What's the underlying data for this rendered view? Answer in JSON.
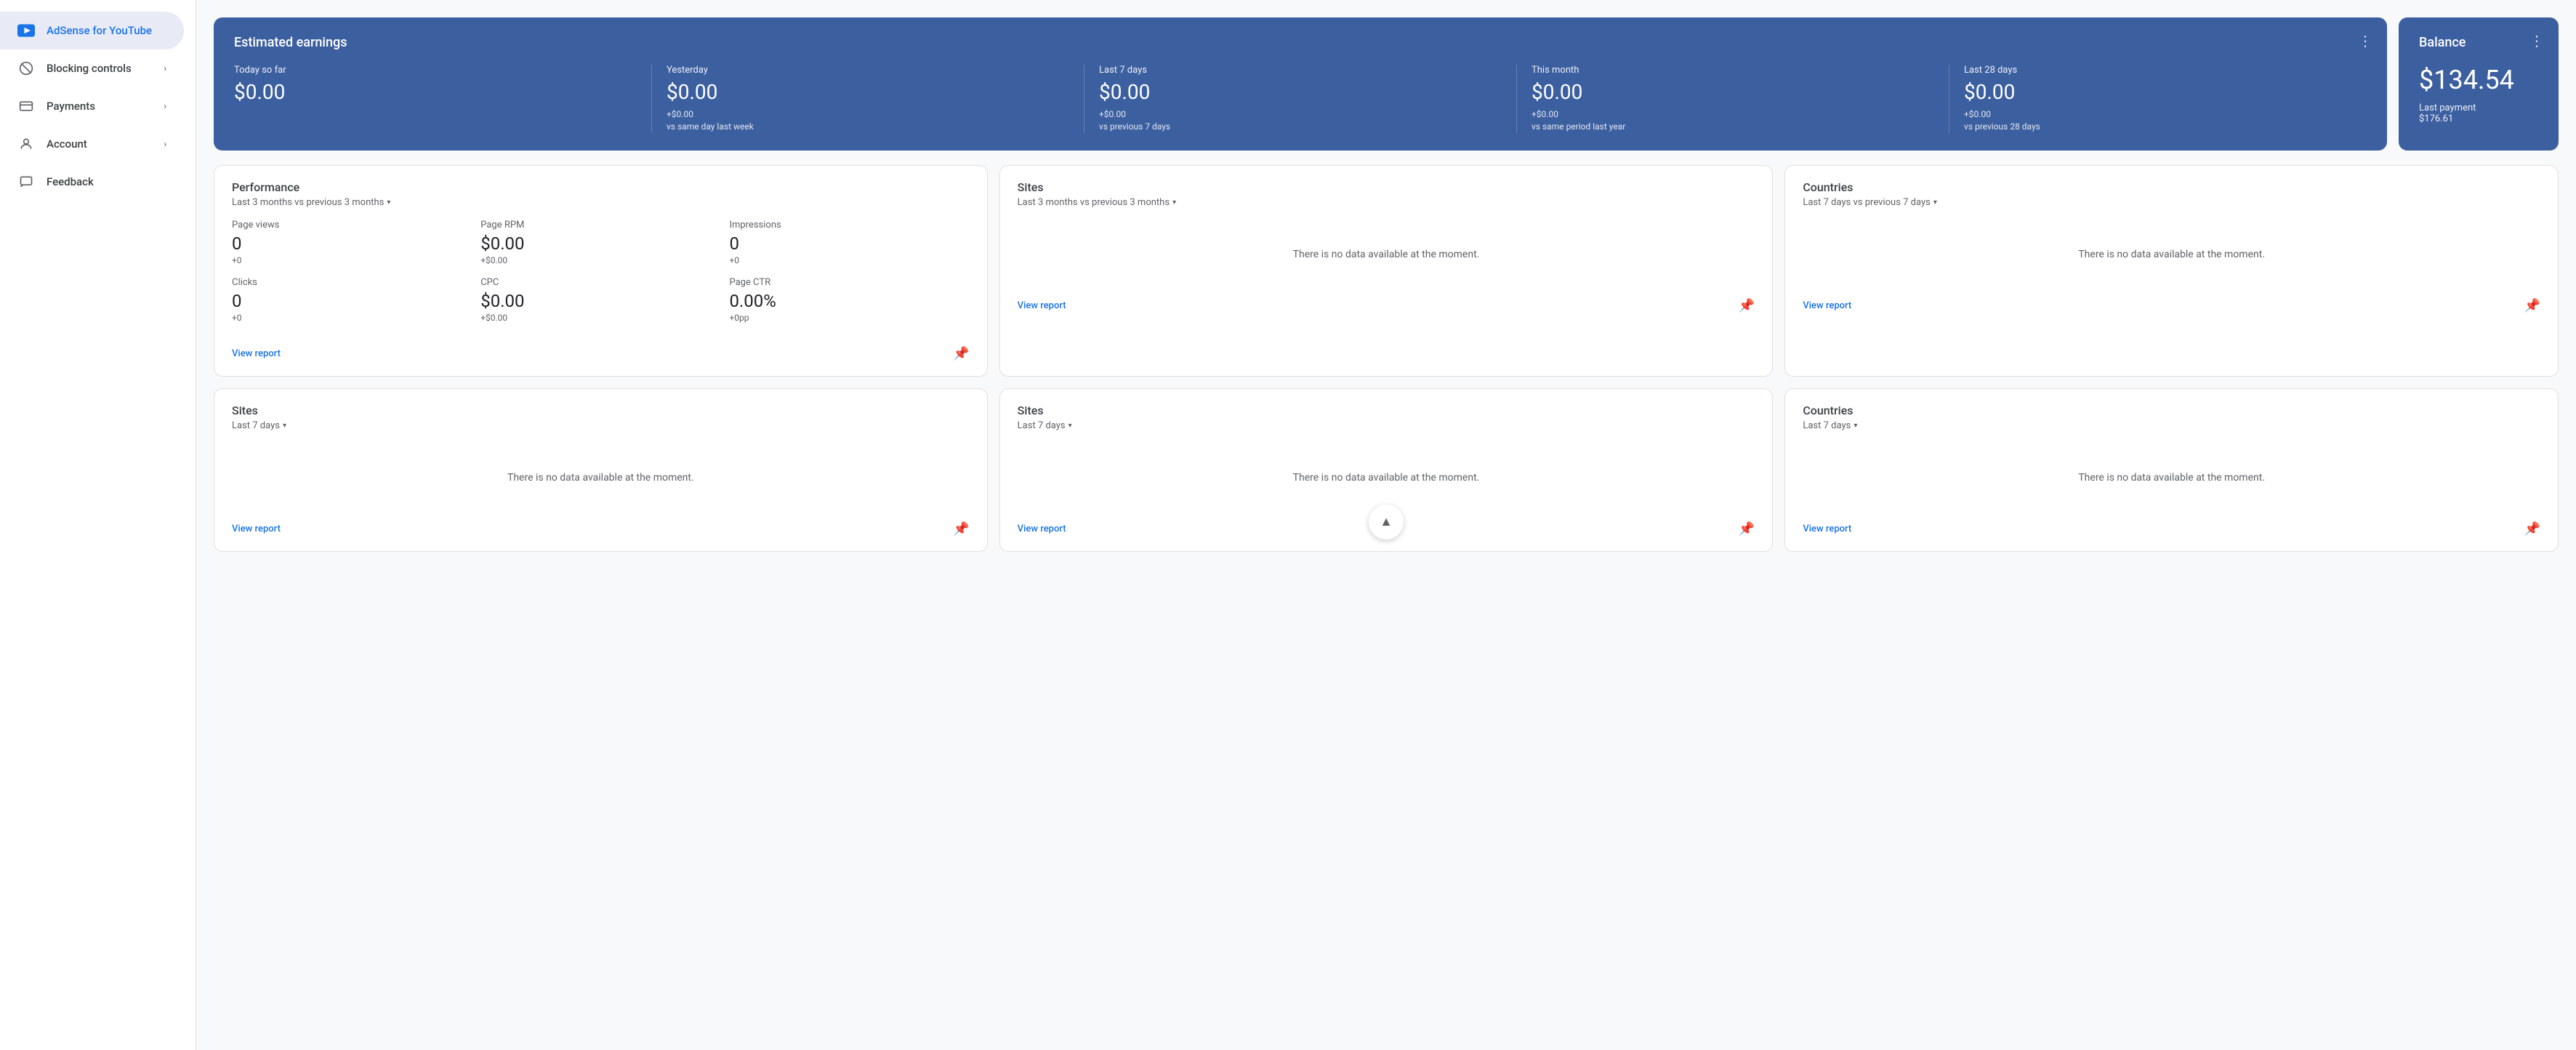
{
  "sidebar": {
    "app_name": "AdSense for YouTube",
    "items": [
      {
        "id": "adsense",
        "label": "AdSense for YouTube",
        "active": true
      },
      {
        "id": "blocking",
        "label": "Blocking controls",
        "active": false,
        "has_arrow": true
      },
      {
        "id": "payments",
        "label": "Payments",
        "active": false,
        "has_arrow": true
      },
      {
        "id": "account",
        "label": "Account",
        "active": false,
        "has_arrow": true
      },
      {
        "id": "feedback",
        "label": "Feedback",
        "active": false
      }
    ]
  },
  "earnings": {
    "card_title": "Estimated earnings",
    "columns": [
      {
        "period": "Today so far",
        "amount": "$0.00",
        "delta": null,
        "delta2": null
      },
      {
        "period": "Yesterday",
        "amount": "$0.00",
        "delta": "+$0.00",
        "delta2": "vs same day last week"
      },
      {
        "period": "Last 7 days",
        "amount": "$0.00",
        "delta": "+$0.00",
        "delta2": "vs previous 7 days"
      },
      {
        "period": "This month",
        "amount": "$0.00",
        "delta": "+$0.00",
        "delta2": "vs same period last year"
      },
      {
        "period": "Last 28 days",
        "amount": "$0.00",
        "delta": "+$0.00",
        "delta2": "vs previous 28 days"
      }
    ]
  },
  "balance": {
    "title": "Balance",
    "amount": "$134.54",
    "last_payment_label": "Last payment",
    "last_payment_value": "$176.61"
  },
  "performance_widget": {
    "title": "Performance",
    "subtitle": "Last 3 months vs previous 3 months",
    "metrics": [
      {
        "label": "Page views",
        "value": "0",
        "delta": "+0",
        "is_dollar": false
      },
      {
        "label": "Page RPM",
        "value": "$0.00",
        "delta": "+$0.00",
        "is_dollar": true
      },
      {
        "label": "Impressions",
        "value": "0",
        "delta": "+0",
        "is_dollar": false
      },
      {
        "label": "Clicks",
        "value": "0",
        "delta": "+0",
        "is_dollar": false
      },
      {
        "label": "CPC",
        "value": "$0.00",
        "delta": "+$0.00",
        "is_dollar": true
      },
      {
        "label": "Page CTR",
        "value": "0.00%",
        "delta": "+0pp",
        "is_dollar": false
      }
    ],
    "view_report": "View report"
  },
  "sites_widget_1": {
    "title": "Sites",
    "subtitle": "Last 3 months vs previous 3 months",
    "no_data": "There is no data available at the moment.",
    "view_report": "View report"
  },
  "countries_widget_1": {
    "title": "Countries",
    "subtitle": "Last 7 days vs previous 7 days",
    "no_data": "There is no data available at the moment.",
    "view_report": "View report"
  },
  "sites_widget_2": {
    "title": "Sites",
    "subtitle": "Last 7 days",
    "no_data": "There is no data available at the moment.",
    "view_report": "View report"
  },
  "countries_widget_2": {
    "title": "Countries",
    "subtitle": "Last 7 days",
    "no_data": "There is no data available at the moment.",
    "view_report": "View report"
  },
  "sites_widget_bottom": {
    "title": "Sites",
    "subtitle": "Last 7 days",
    "no_data": "There is no data available at the moment.",
    "view_report": "View report"
  },
  "icons": {
    "menu_dots": "⋮",
    "dropdown_arrow": "▾",
    "pin": "📌",
    "arrow_up": "▲",
    "chevron_right": "›"
  }
}
